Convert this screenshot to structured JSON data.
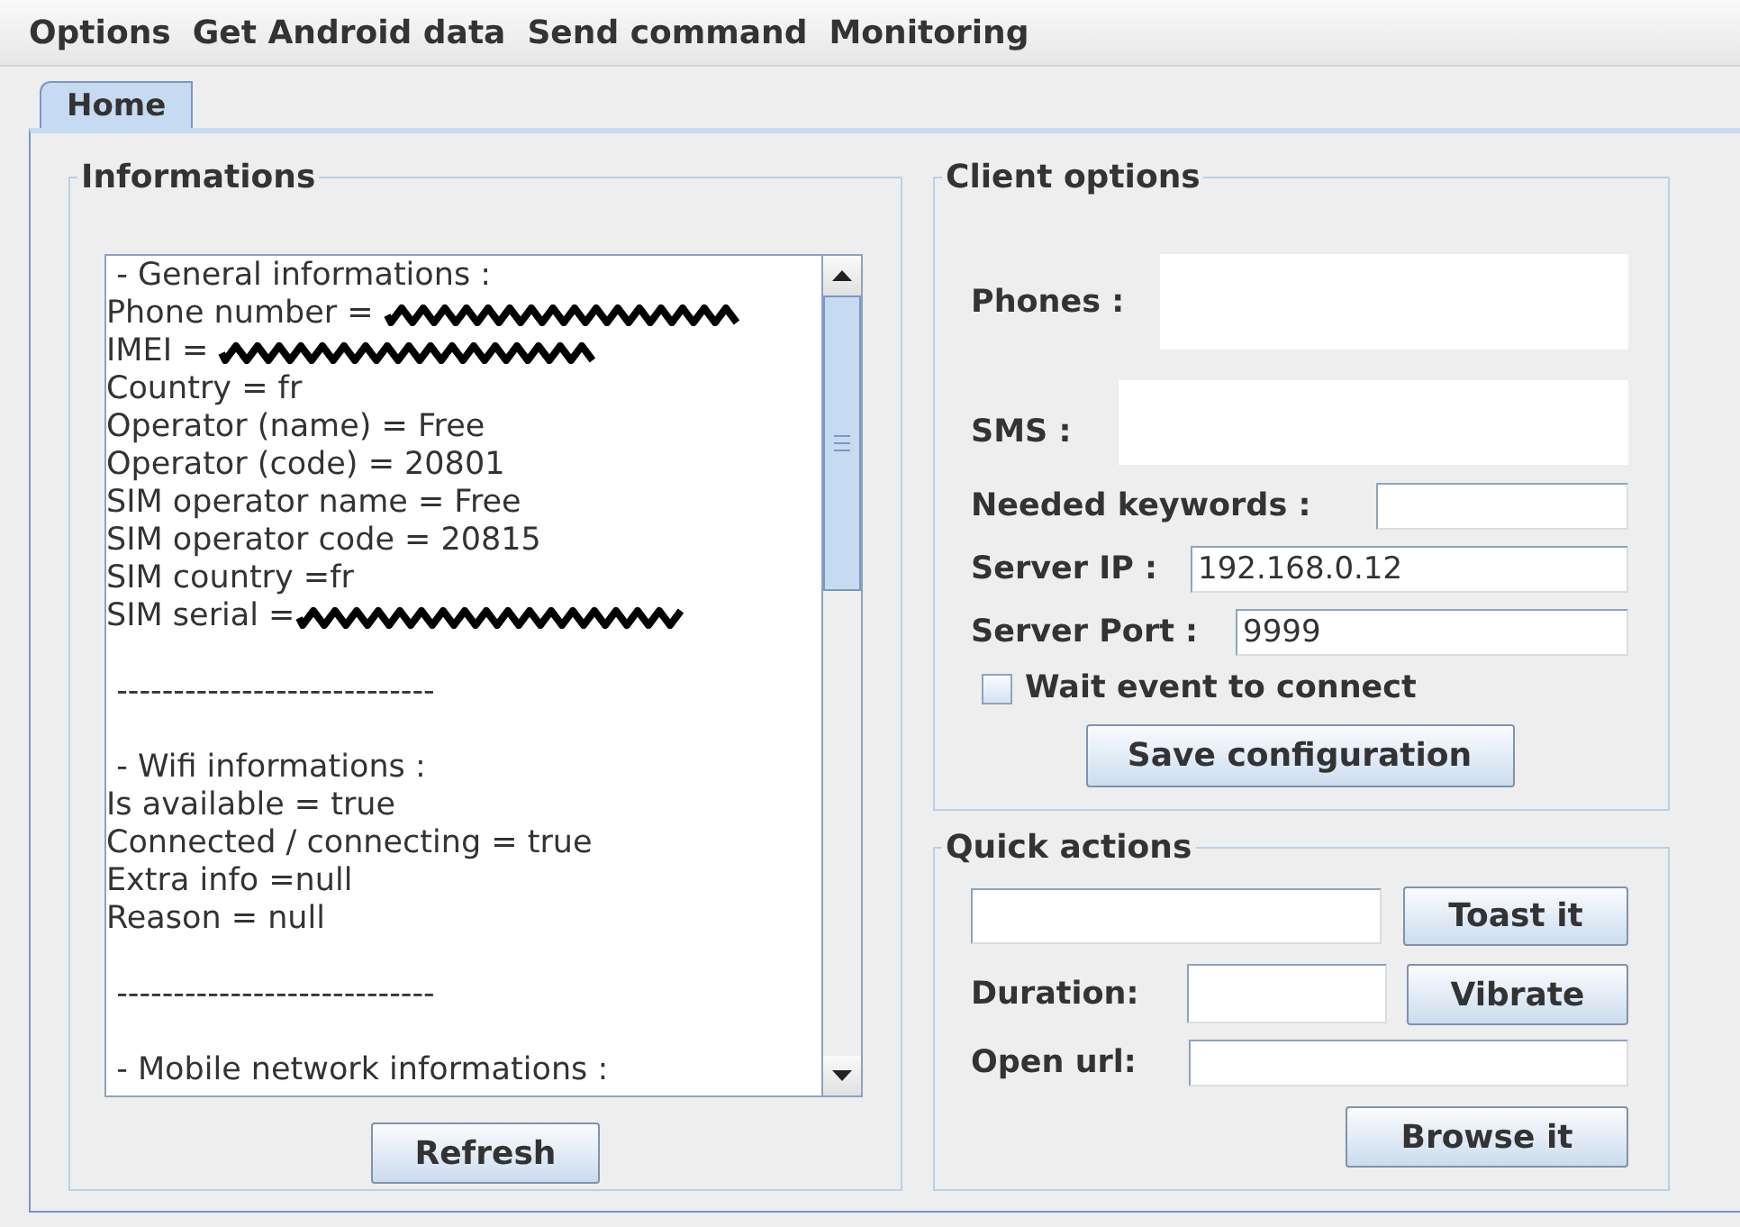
{
  "menu": [
    "Options",
    "Get Android data",
    "Send command",
    "Monitoring"
  ],
  "tabs": [
    {
      "label": "Home",
      "selected": true
    }
  ],
  "informations": {
    "title": "Informations",
    "lines": [
      {
        "text": " - General informations :",
        "redacted": false
      },
      {
        "text": "Phone number = ",
        "redacted": true
      },
      {
        "text": "IMEI = ",
        "redacted": true
      },
      {
        "text": "Country = fr",
        "redacted": false
      },
      {
        "text": "Operator (name) = Free",
        "redacted": false
      },
      {
        "text": "Operator (code) = 20801",
        "redacted": false
      },
      {
        "text": "SIM operator name = Free",
        "redacted": false
      },
      {
        "text": "SIM operator code = 20815",
        "redacted": false
      },
      {
        "text": "SIM country =fr",
        "redacted": false
      },
      {
        "text": "SIM serial =",
        "redacted": true
      },
      {
        "redacted": false
      },
      {
        "text": " ----------------------------",
        "redacted": false
      },
      {
        "redacted": false
      },
      {
        "text": " - Wifi informations :",
        "redacted": false
      },
      {
        "text": "Is available = true",
        "redacted": false
      },
      {
        "text": "Connected / connecting = true",
        "redacted": false
      },
      {
        "text": "Extra info =null",
        "redacted": false
      },
      {
        "text": "Reason = null",
        "redacted": false
      },
      {
        "redacted": false
      },
      {
        "text": " ----------------------------",
        "redacted": false
      },
      {
        "redacted": false
      },
      {
        "text": " - Mobile network informations :",
        "redacted": false
      }
    ],
    "refresh_button": "Refresh"
  },
  "client_options": {
    "title": "Client options",
    "phones": {
      "label": "Phones :"
    },
    "sms": {
      "label": "SMS :"
    },
    "needed_keywords": {
      "label": "Needed keywords :"
    },
    "server_ip": {
      "label": "Server IP :",
      "value": "192.168.0.12"
    },
    "server_port": {
      "label": "Server Port :",
      "value": "9999"
    },
    "wait_event": {
      "label": "Wait event to connect",
      "checked": false
    },
    "save_button": "Save configuration"
  },
  "quick_actions": {
    "title": "Quick actions",
    "toast_button": "Toast it",
    "duration": {
      "label": "Duration:"
    },
    "vibrate_button": "Vibrate",
    "open_url": {
      "label": "Open url:"
    },
    "browse_button": "Browse it"
  }
}
